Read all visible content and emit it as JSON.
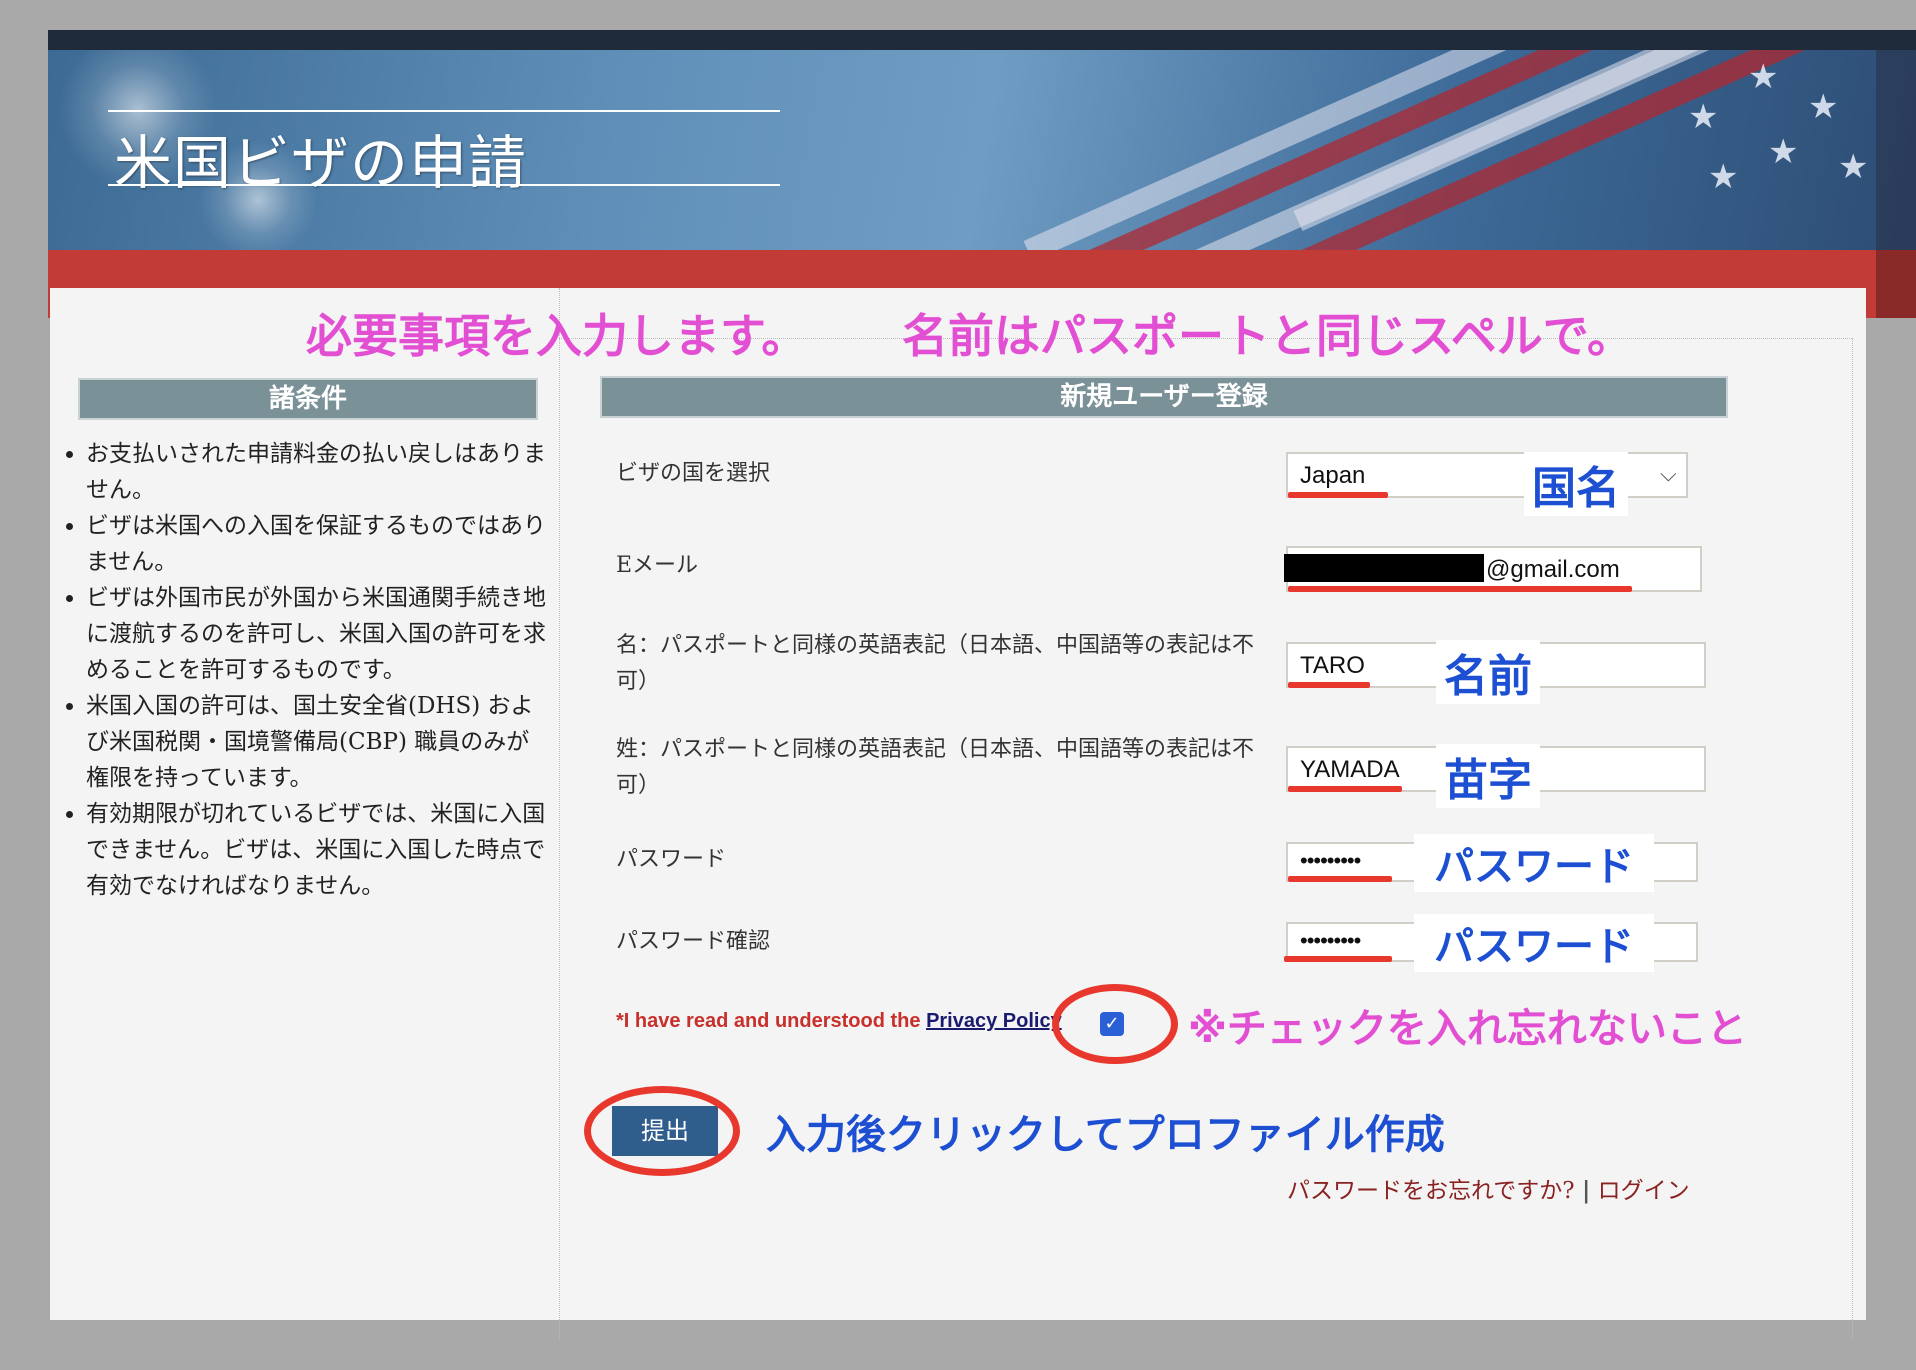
{
  "header": {
    "title": "米国ビザの申請"
  },
  "annotations": {
    "top_instruction_1": "必要事項を入力します。",
    "top_instruction_2": "名前はパスポートと同じスペルで。",
    "country_hint": "国名",
    "first_name_hint": "名前",
    "last_name_hint": "苗字",
    "password_hint": "パスワード",
    "password_confirm_hint": "パスワード",
    "checkbox_hint": "※チェックを入れ忘れないこと",
    "submit_hint": "入力後クリックしてプロファイル作成"
  },
  "sidebar": {
    "heading": "諸条件",
    "items": [
      "お支払いされた申請料金の払い戻しはありません。",
      "ビザは米国への入国を保証するものではありません。",
      "ビザは外国市民が外国から米国通関手続き地に渡航するのを許可し、米国入国の許可を求めることを許可するものです。",
      "米国入国の許可は、国土安全省(DHS) および米国税関・国境警備局(CBP) 職員のみが権限を持っています。",
      "有効期限が切れているビザでは、米国に入国できません。ビザは、米国に入国した時点で有効でなければなりません。"
    ]
  },
  "form": {
    "heading": "新規ユーザー登録",
    "country_label": "ビザの国を選択",
    "country_value": "Japan",
    "email_label": "Eメール",
    "email_value": "@gmail.com",
    "first_name_label": "名：パスポートと同様の英語表記（日本語、中国語等の表記は不可）",
    "first_name_value": "TARO",
    "last_name_label": "姓：パスポートと同様の英語表記（日本語、中国語等の表記は不可）",
    "last_name_value": "YAMADA",
    "password_label": "パスワード",
    "password_value": "•••••••••",
    "password_confirm_label": "パスワード確認",
    "password_confirm_value": "•••••••••",
    "privacy_prefix": "*I have read and understood the ",
    "privacy_link": "Privacy Policy",
    "privacy_checked": true,
    "submit_label": "提出",
    "forgot_password": "パスワードをお忘れですか?",
    "separator": "|",
    "login": "ログイン"
  },
  "colors": {
    "header_red": "#c23b37",
    "section_header": "#7a9198",
    "submit_button": "#2f5e8c",
    "annotation_pink": "#e24fd3",
    "annotation_blue": "#1d4fd3",
    "annotation_red": "#e8382d"
  }
}
